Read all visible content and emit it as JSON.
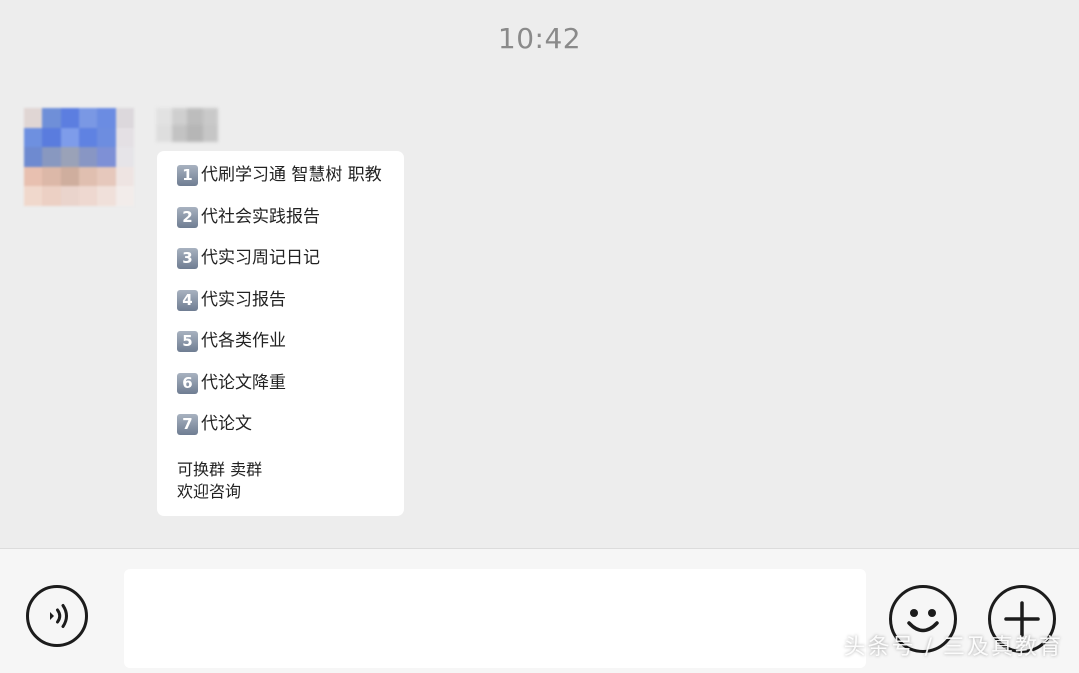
{
  "header": {
    "time": "10:42"
  },
  "message": {
    "items": [
      {
        "num": "1",
        "text": "代刷学习通 智慧树 职教"
      },
      {
        "num": "2",
        "text": "代社会实践报告"
      },
      {
        "num": "3",
        "text": "代实习周记日记"
      },
      {
        "num": "4",
        "text": "代实习报告"
      },
      {
        "num": "5",
        "text": "代各类作业"
      },
      {
        "num": "6",
        "text": "代论文降重"
      },
      {
        "num": "7",
        "text": "代论文"
      }
    ],
    "footer_line1": "可换群 卖群",
    "footer_line2": "欢迎咨询"
  },
  "input": {
    "value": "",
    "placeholder": ""
  },
  "icons": {
    "voice": "voice-icon",
    "emoji": "emoji-icon",
    "more": "plus-icon"
  },
  "watermark": "头条号 / 三及真教育",
  "colors": {
    "background": "#ededed",
    "bubble": "#ffffff",
    "badge": "#7d8aa0"
  }
}
